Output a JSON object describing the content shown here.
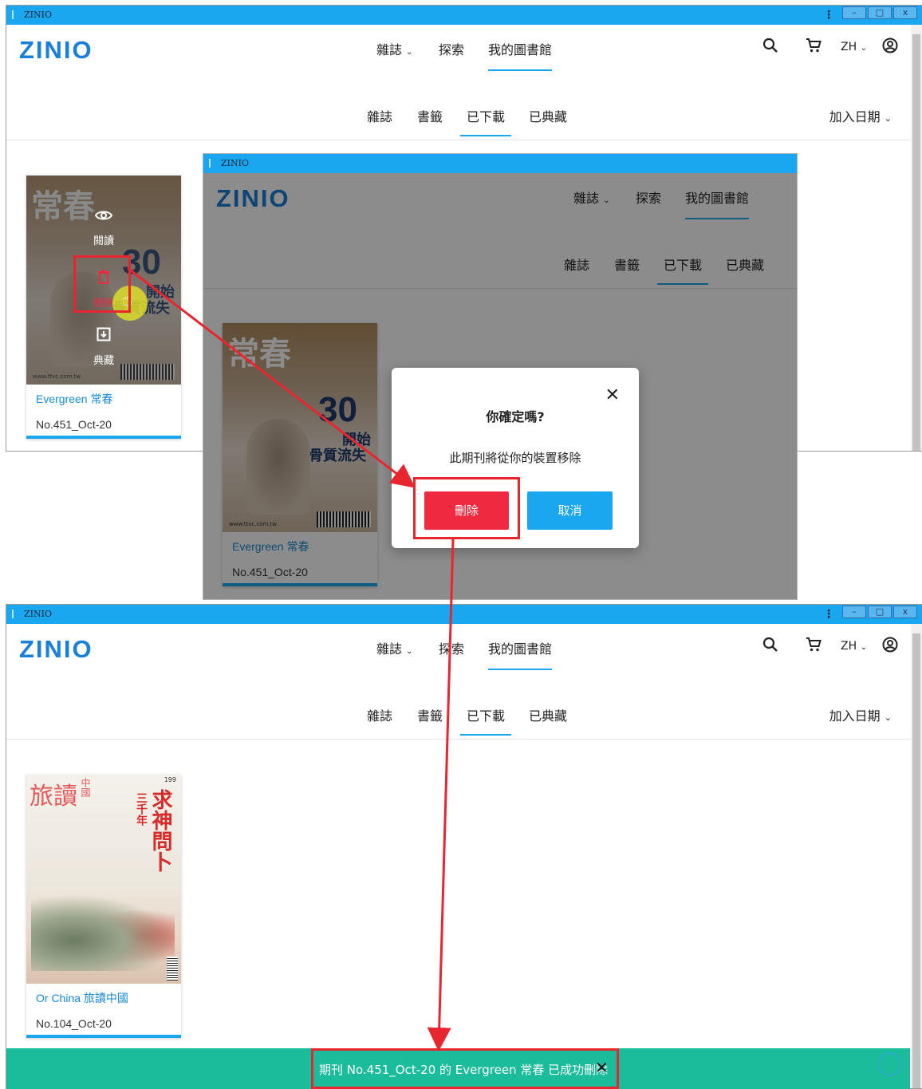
{
  "app": {
    "window_title": "ZINIO",
    "logo": "ZINIO"
  },
  "nav": {
    "magazines": "雜誌",
    "explore": "探索",
    "library": "我的圖書館",
    "lang": "ZH"
  },
  "tabs": {
    "magazines": "雜誌",
    "bookmarks": "書籤",
    "downloaded": "已下載",
    "archived": "已典藏"
  },
  "sort": {
    "label": "加入日期"
  },
  "icons": {
    "search": "search-icon",
    "cart": "cart-icon",
    "account": "account-icon",
    "chevron": "chevron-down-icon",
    "read": "eye-icon",
    "delete": "trash-icon",
    "archive": "archive-icon",
    "close": "close-icon",
    "kebab": "kebab-icon"
  },
  "window_buttons": {
    "minimize": "–",
    "maximize": "□",
    "close": "x"
  },
  "card_menu": {
    "read": "閱讀",
    "delete": "刪除",
    "archive": "典藏"
  },
  "card1": {
    "title": "Evergreen 常春",
    "issue": "No.451_Oct-20",
    "cover_title": "常春",
    "cover_big": "30",
    "cover_sub1": "開始",
    "cover_sub2": "骨質流失",
    "cover_url": "www.ttvc.com.tw"
  },
  "card2": {
    "title": "Or China 旅讀中國",
    "issue": "No.104_Oct-20",
    "cover_title": "旅讀",
    "cover_title_small": "中國",
    "cover_vert1": "求神問卜",
    "cover_vert2": "三千年",
    "cover_price": "199"
  },
  "dialog": {
    "title": "你確定嗎?",
    "message": "此期刊將從你的裝置移除",
    "delete_label": "刪除",
    "cancel_label": "取消"
  },
  "toast": {
    "message": "期刊 No.451_Oct-20 的 Evergreen 常春 已成功刪除"
  },
  "colors": {
    "accent": "#1aa7f0",
    "danger": "#ef2940",
    "success": "#1abc9c",
    "annotation": "#e8262f"
  }
}
